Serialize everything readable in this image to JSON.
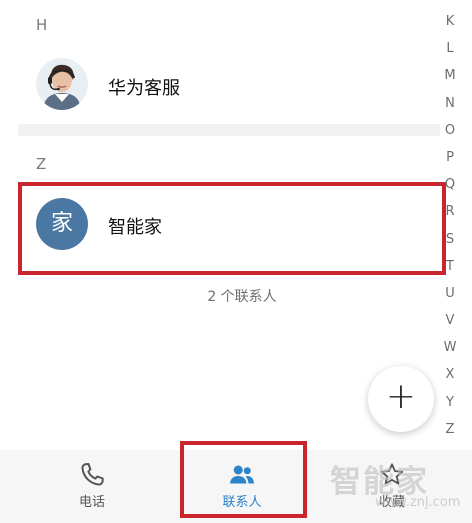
{
  "colors": {
    "accent": "#2d84c9",
    "highlight": "#c8262c",
    "avatar_blue": "#4b78a3",
    "section_band": "#f1f1f1"
  },
  "sections": [
    {
      "letter": "H",
      "contacts": [
        {
          "name": "华为客服",
          "avatar_type": "photo",
          "avatar_icon": "support-agent-photo"
        }
      ]
    },
    {
      "letter": "Z",
      "contacts": [
        {
          "name": "智能家",
          "avatar_type": "initial",
          "avatar_text": "家"
        }
      ]
    }
  ],
  "contact_count": "2 个联系人",
  "alphabet": [
    "K",
    "L",
    "M",
    "N",
    "O",
    "P",
    "Q",
    "R",
    "S",
    "T",
    "U",
    "V",
    "W",
    "X",
    "Y",
    "Z"
  ],
  "fab": {
    "icon": "plus-icon",
    "label": "+"
  },
  "bottom_nav": {
    "items": [
      {
        "label": "电话",
        "icon": "phone-icon",
        "active": false
      },
      {
        "label": "联系人",
        "icon": "contacts-icon",
        "active": true
      },
      {
        "label": "收藏",
        "icon": "star-icon",
        "active": false
      }
    ]
  },
  "watermark": {
    "main": "智能家",
    "sub": "www.znj.com"
  }
}
